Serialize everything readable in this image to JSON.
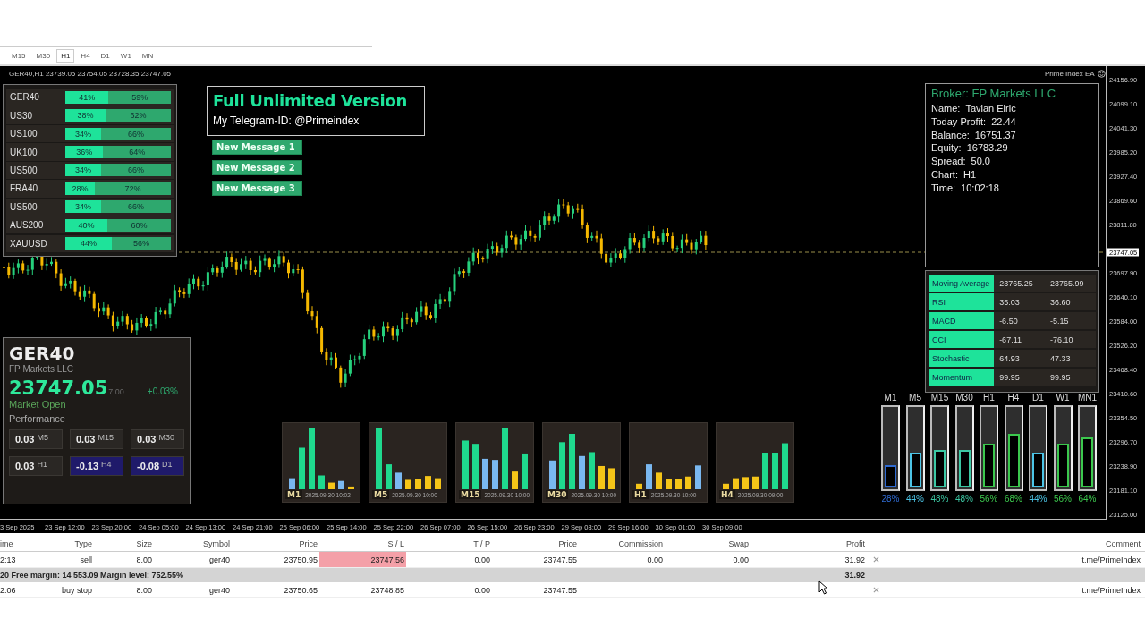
{
  "window": {
    "timeframes": [
      {
        "label": "M15",
        "selected": false
      },
      {
        "label": "M30",
        "selected": false
      },
      {
        "label": "H1",
        "selected": true
      },
      {
        "label": "H4",
        "selected": false
      },
      {
        "label": "D1",
        "selected": false
      },
      {
        "label": "W1",
        "selected": false
      },
      {
        "label": "MN",
        "selected": false
      }
    ]
  },
  "chart": {
    "header": "GER40,H1  23739.05 23754.05 23728.35 23747.05",
    "ea_label": "Prime Index EA",
    "current_price": "23747.05",
    "price_axis": [
      "24156.90",
      "24099.10",
      "24041.30",
      "23985.20",
      "23927.40",
      "23869.60",
      "23811.80",
      "23697.90",
      "23640.10",
      "23584.00",
      "23526.20",
      "23468.40",
      "23410.60",
      "23354.50",
      "23296.70",
      "23238.90",
      "23181.10",
      "23125.00"
    ],
    "time_axis": [
      "3 Sep 2025",
      "23 Sep 12:00",
      "23 Sep 20:00",
      "24 Sep 05:00",
      "24 Sep 13:00",
      "24 Sep 21:00",
      "25 Sep 06:00",
      "25 Sep 14:00",
      "25 Sep 22:00",
      "26 Sep 07:00",
      "26 Sep 15:00",
      "26 Sep 23:00",
      "29 Sep 08:00",
      "29 Sep 16:00",
      "30 Sep 01:00",
      "30 Sep 09:00"
    ]
  },
  "pairs": [
    {
      "symbol": "GER40",
      "buy": "41%",
      "sell": "59%",
      "level": 0.41
    },
    {
      "symbol": "US30",
      "buy": "38%",
      "sell": "62%",
      "level": 0.38
    },
    {
      "symbol": "US100",
      "buy": "34%",
      "sell": "66%",
      "level": 0.34
    },
    {
      "symbol": "UK100",
      "buy": "36%",
      "sell": "64%",
      "level": 0.36
    },
    {
      "symbol": "US500",
      "buy": "34%",
      "sell": "66%",
      "level": 0.34
    },
    {
      "symbol": "FRA40",
      "buy": "28%",
      "sell": "72%",
      "level": 0.28
    },
    {
      "symbol": "US500",
      "buy": "34%",
      "sell": "66%",
      "level": 0.34
    },
    {
      "symbol": "AUS200",
      "buy": "40%",
      "sell": "60%",
      "level": 0.4
    },
    {
      "symbol": "XAUUSD",
      "buy": "44%",
      "sell": "56%",
      "level": 0.44
    }
  ],
  "promo": {
    "title": "Full Unlimited Version",
    "subtitle": "My Telegram-ID: @Primeindex"
  },
  "messages": [
    "New Message 1",
    "New Message 2",
    "New Message 3"
  ],
  "account": {
    "broker": "Broker: FP Markets LLC",
    "rows": [
      {
        "label": "Name:",
        "value": "Tavian Elric"
      },
      {
        "label": "Today Profit:",
        "value": "22.44"
      },
      {
        "label": "Balance:",
        "value": "16751.37"
      },
      {
        "label": "Equity:",
        "value": "16783.29"
      },
      {
        "label": "Spread:",
        "value": "50.0"
      },
      {
        "label": "Chart:",
        "value": "H1"
      },
      {
        "label": "Time:",
        "value": "10:02:18"
      }
    ]
  },
  "indicators": [
    {
      "name": "Moving Average",
      "value_1": "23765.25",
      "value_2": "23765.99"
    },
    {
      "name": "RSI",
      "value_1": "35.03",
      "value_2": "36.60"
    },
    {
      "name": "MACD",
      "value_1": "-6.50",
      "value_2": "-5.15"
    },
    {
      "name": "CCI",
      "value_1": "-67.11",
      "value_2": "-76.10"
    },
    {
      "name": "Stochastic",
      "value_1": "64.93",
      "value_2": "47.33"
    },
    {
      "name": "Momentum",
      "value_1": "99.95",
      "value_2": "99.95"
    }
  ],
  "symbol_card": {
    "symbol": "GER40",
    "broker": "FP Markets LLC",
    "price": "23747.05",
    "hidden_price": "7.00",
    "change": "+0.03%",
    "status": "Market Open",
    "performance_title": "Performance",
    "performance": [
      {
        "value": "0.03",
        "timeframe": "M5",
        "color": "#2a2724"
      },
      {
        "value": "0.03",
        "timeframe": "M15",
        "color": "#2a2724"
      },
      {
        "value": "0.03",
        "timeframe": "M30",
        "color": "#2a2724"
      },
      {
        "value": "0.03",
        "timeframe": "H1",
        "color": "#2a2724"
      },
      {
        "value": "-0.13",
        "timeframe": "H4",
        "color": "#1f1a6a"
      },
      {
        "value": "-0.08",
        "timeframe": "D1",
        "color": "#1f1a6a"
      }
    ]
  },
  "mini_charts": [
    {
      "timeframe": "M1",
      "time": "2025.09.30 10:02"
    },
    {
      "timeframe": "M5",
      "time": "2025.09.30 10:00"
    },
    {
      "timeframe": "M15",
      "time": "2025.09.30 10:00"
    },
    {
      "timeframe": "M30",
      "time": "2025.09.30 10:00"
    },
    {
      "timeframe": "H1",
      "time": "2025.09.30 10:00"
    },
    {
      "timeframe": "H4",
      "time": "2025.09.30 09:00"
    }
  ],
  "meters": [
    {
      "timeframe": "M1",
      "level": 0.28,
      "reading": "28%",
      "color": "#2f6ad0"
    },
    {
      "timeframe": "M5",
      "level": 0.44,
      "reading": "44%",
      "color": "#4cc4e6"
    },
    {
      "timeframe": "M15",
      "level": 0.48,
      "reading": "48%",
      "color": "#3cc8a4"
    },
    {
      "timeframe": "M30",
      "level": 0.48,
      "reading": "48%",
      "color": "#3cc8a4"
    },
    {
      "timeframe": "H1",
      "level": 0.56,
      "reading": "56%",
      "color": "#3cc84e"
    },
    {
      "timeframe": "H4",
      "level": 0.68,
      "reading": "68%",
      "color": "#3cc84e"
    },
    {
      "timeframe": "D1",
      "level": 0.44,
      "reading": "44%",
      "color": "#4cc4e6"
    },
    {
      "timeframe": "W1",
      "level": 0.56,
      "reading": "56%",
      "color": "#3cc84e"
    },
    {
      "timeframe": "MN1",
      "level": 0.64,
      "reading": "64%",
      "color": "#3cc84e"
    }
  ],
  "trade_table": {
    "columns": [
      "ime",
      "Type",
      "Size",
      "Symbol",
      "Price",
      "S / L",
      "T / P",
      "Price",
      "Commission",
      "Swap",
      "Profit",
      "Comment"
    ],
    "rows": [
      {
        "kind": "order",
        "time": "2:13",
        "type": "sell",
        "size": "8.00",
        "symbol": "ger40",
        "price": "23750.95",
        "sl": "23747.56",
        "tp": "0.00",
        "current_price": "23747.55",
        "commission": "0.00",
        "swap": "0.00",
        "profit": "31.92",
        "comment": "t.me/PrimeIndex",
        "sl_highlighted": true
      },
      {
        "kind": "summary",
        "text": "20 Free margin: 14 553.09  Margin level: 752.55%",
        "profit": "31.92"
      },
      {
        "kind": "order",
        "time": "2:06",
        "type": "buy stop",
        "size": "8.00",
        "symbol": "ger40",
        "price": "23750.65",
        "sl": "23748.85",
        "tp": "0.00",
        "current_price": "23747.55",
        "comment": "t.me/PrimeIndex",
        "sl_highlighted": false
      }
    ]
  }
}
